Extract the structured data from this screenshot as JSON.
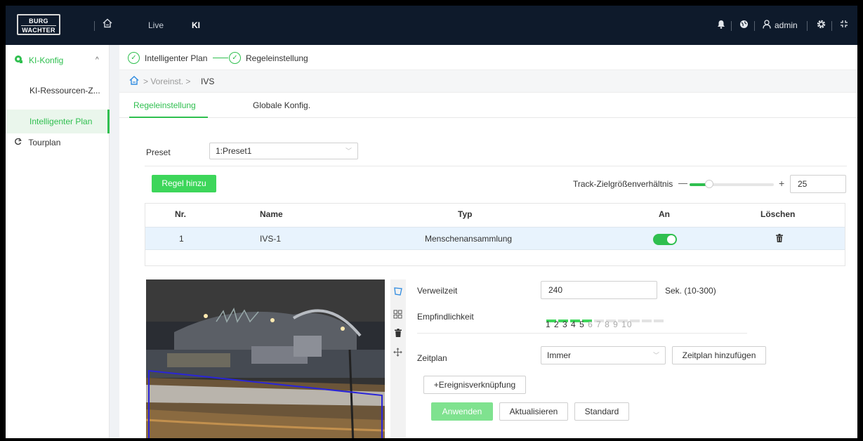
{
  "header": {
    "logo_line1": "BURG",
    "logo_line2": "WACHTER",
    "nav": [
      "Live",
      "KI"
    ],
    "user": "admin"
  },
  "sidebar": {
    "section": "KI-Konfig",
    "items": [
      {
        "label": "KI-Ressourcen-Z..."
      },
      {
        "label": "Intelligenter Plan"
      }
    ],
    "tourplan": "Tourplan"
  },
  "steps": [
    "Intelligenter Plan",
    "Regeleinstellung"
  ],
  "breadcrumb": {
    "path": "> Voreinst. >",
    "current": "IVS"
  },
  "tabs": [
    "Regeleinstellung",
    "Globale Konfig."
  ],
  "preset": {
    "label": "Preset",
    "value": "1:Preset1"
  },
  "add_rule_button": "Regel hinzu",
  "track": {
    "label": "Track-Zielgrößenverhältnis",
    "value": "25",
    "level": 0.2
  },
  "rules_table": {
    "headers": [
      "Nr.",
      "Name",
      "Typ",
      "An",
      "Löschen"
    ],
    "rows": [
      {
        "nr": "1",
        "name": "IVS-1",
        "typ": "Menschenansammlung",
        "enabled": true
      }
    ]
  },
  "form": {
    "dwell_label": "Verweilzeit",
    "dwell_value": "240",
    "dwell_unit": "Sek. (10-300)",
    "sensitivity_label": "Empfindlichkeit",
    "sensitivity_value": 5,
    "sensitivity_scale": "1 2 3 4 5 6 7 8 9 10",
    "schedule_label": "Zeitplan",
    "schedule_value": "Immer",
    "add_schedule_button": "Zeitplan hinzufügen",
    "event_link_button": "+Ereignisverknüpfung"
  },
  "actions": {
    "apply": "Anwenden",
    "refresh": "Aktualisieren",
    "default": "Standard"
  },
  "colors": {
    "accent": "#2fbf4f",
    "header_bg": "#0e1a2b",
    "row_highlight": "#e8f3fd"
  }
}
